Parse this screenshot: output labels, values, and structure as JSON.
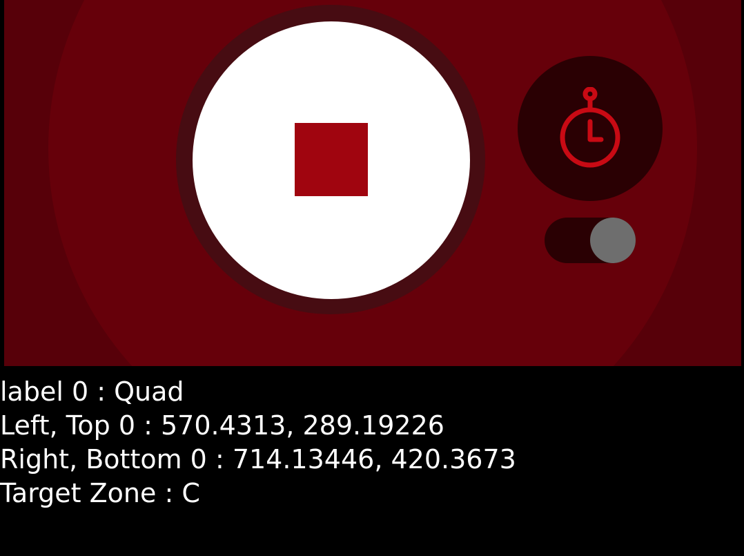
{
  "colors": {
    "panel_background": "#570009",
    "halo": "#66000a",
    "shutter_ring": "#470c12",
    "shutter_fill": "#ffffff",
    "stop_square": "#a0050f",
    "control_background": "#2a0003",
    "timer_icon": "#c80a14",
    "toggle_knob": "#6e6e6e",
    "page_background": "#000000",
    "overlay_text": "#ffffff"
  },
  "controls": {
    "shutter_icon": "stop-square-icon",
    "timer_icon": "stopwatch-icon",
    "toggle_state": "on"
  },
  "overlay": {
    "lines": [
      "label 0 : Quad",
      "Left, Top 0 : 570.4313, 289.19226",
      "Right, Bottom 0 : 714.13446, 420.3673",
      "Target Zone : C"
    ]
  }
}
